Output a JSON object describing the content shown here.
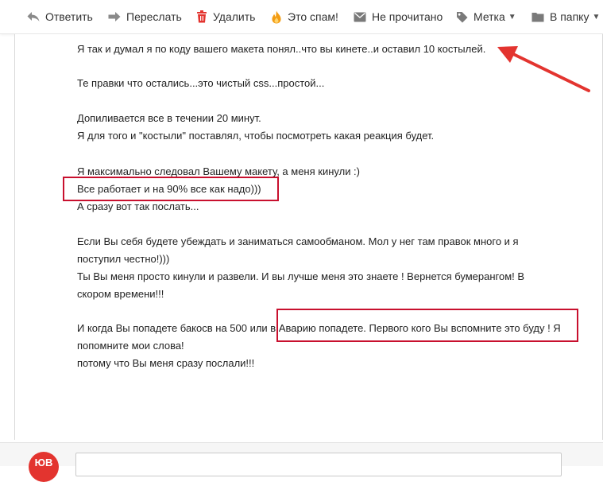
{
  "toolbar": {
    "reply": "Ответить",
    "forward": "Переслать",
    "delete": "Удалить",
    "spam": "Это спам!",
    "unread": "Не прочитано",
    "label": "Метка",
    "move": "В папку"
  },
  "colors": {
    "delete_icon": "#e3342f",
    "spam_icon": "#f39c12",
    "highlight": "#c8102e",
    "avatar": "#e3342f"
  },
  "message": {
    "lines": [
      "Я так и думал я по коду вашего макета понял..что вы кинете..и оставил 10 костылей.",
      "Те правки что остались...это чистый css...простой...",
      "Допиливается все в течении 20 минут.",
      "Я для того и \"костыли\" поставлял, чтобы посмотреть какая реакция будет.",
      "Я максимально следовал Вашему макету, а меня кинули :)",
      "Все работает и на 90% все как надо)))",
      "А сразу вот так послать...",
      "Если Вы себя будете убеждать и заниматься самообманом. Мол у нег там правок много и я",
      "поступил честно!)))",
      "Ты Вы меня просто кинули и развели. И вы лучше меня это знаете ! Вернется бумерангом! В",
      "скором времени!!!",
      "И когда Вы попадете бакосв на 500 или в Аварию попадете. Первого кого Вы вспомните это буду ! Я",
      "попомните мои слова!",
      "потому что Вы меня сразу послали!!!"
    ]
  },
  "reply": {
    "avatar_initials": "ЮВ"
  }
}
